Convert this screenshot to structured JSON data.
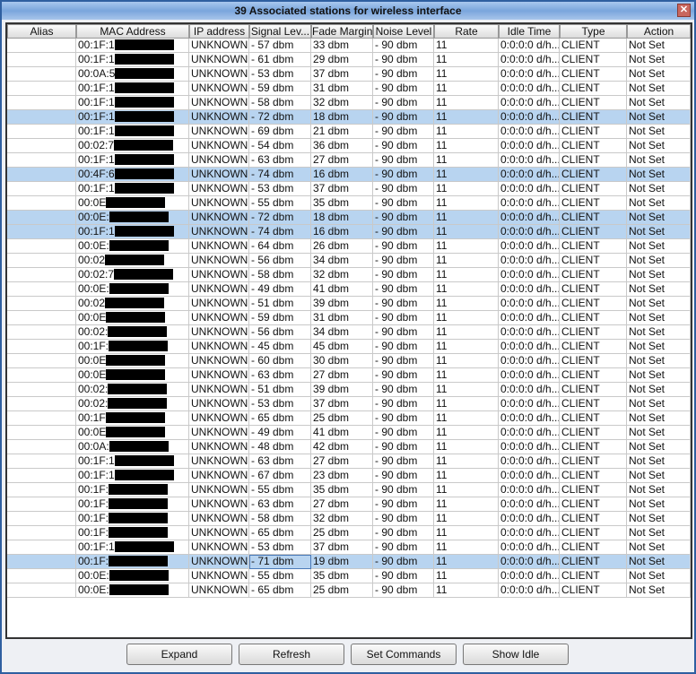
{
  "title": "39 Associated stations for wireless interface",
  "columns": [
    "Alias",
    "MAC Address",
    "IP address",
    "Signal Lev...",
    "Fade Margin",
    "Noise Level",
    "Rate",
    "Idle Time",
    "Type",
    "Action"
  ],
  "rows": [
    [
      "",
      "00:1F:1",
      "UNKNOWN",
      "- 57 dbm",
      "33 dbm",
      "- 90 dbm",
      "11",
      "0:0:0:0 d/h...",
      "CLIENT",
      "Not Set",
      0
    ],
    [
      "",
      "00:1F:1",
      "UNKNOWN",
      "- 61 dbm",
      "29 dbm",
      "- 90 dbm",
      "11",
      "0:0:0:0 d/h...",
      "CLIENT",
      "Not Set",
      0
    ],
    [
      "",
      "00:0A:5",
      "UNKNOWN",
      "- 53 dbm",
      "37 dbm",
      "- 90 dbm",
      "11",
      "0:0:0:0 d/h...",
      "CLIENT",
      "Not Set",
      0
    ],
    [
      "",
      "00:1F:1",
      "UNKNOWN",
      "- 59 dbm",
      "31 dbm",
      "- 90 dbm",
      "11",
      "0:0:0:0 d/h...",
      "CLIENT",
      "Not Set",
      0
    ],
    [
      "",
      "00:1F:1",
      "UNKNOWN",
      "- 58 dbm",
      "32 dbm",
      "- 90 dbm",
      "11",
      "0:0:0:0 d/h...",
      "CLIENT",
      "Not Set",
      0
    ],
    [
      "",
      "00:1F:1",
      "UNKNOWN",
      "- 72 dbm",
      "18 dbm",
      "- 90 dbm",
      "11",
      "0:0:0:0 d/h...",
      "CLIENT",
      "Not Set",
      1
    ],
    [
      "",
      "00:1F:1",
      "UNKNOWN",
      "- 69 dbm",
      "21 dbm",
      "- 90 dbm",
      "11",
      "0:0:0:0 d/h...",
      "CLIENT",
      "Not Set",
      0
    ],
    [
      "",
      "00:02:7",
      "UNKNOWN",
      "- 54 dbm",
      "36 dbm",
      "- 90 dbm",
      "11",
      "0:0:0:0 d/h...",
      "CLIENT",
      "Not Set",
      0
    ],
    [
      "",
      "00:1F:1",
      "UNKNOWN",
      "- 63 dbm",
      "27 dbm",
      "- 90 dbm",
      "11",
      "0:0:0:0 d/h...",
      "CLIENT",
      "Not Set",
      0
    ],
    [
      "",
      "00:4F:6",
      "UNKNOWN",
      "- 74 dbm",
      "16 dbm",
      "- 90 dbm",
      "11",
      "0:0:0:0 d/h...",
      "CLIENT",
      "Not Set",
      1
    ],
    [
      "",
      "00:1F:1",
      "UNKNOWN",
      "- 53 dbm",
      "37 dbm",
      "- 90 dbm",
      "11",
      "0:0:0:0 d/h...",
      "CLIENT",
      "Not Set",
      0
    ],
    [
      "",
      "00:0E",
      "UNKNOWN",
      "- 55 dbm",
      "35 dbm",
      "- 90 dbm",
      "11",
      "0:0:0:0 d/h...",
      "CLIENT",
      "Not Set",
      0
    ],
    [
      "",
      "00:0E:",
      "UNKNOWN",
      "- 72 dbm",
      "18 dbm",
      "- 90 dbm",
      "11",
      "0:0:0:0 d/h...",
      "CLIENT",
      "Not Set",
      1
    ],
    [
      "",
      "00:1F:1",
      "UNKNOWN",
      "- 74 dbm",
      "16 dbm",
      "- 90 dbm",
      "11",
      "0:0:0:0 d/h...",
      "CLIENT",
      "Not Set",
      1
    ],
    [
      "",
      "00:0E:",
      "UNKNOWN",
      "- 64 dbm",
      "26 dbm",
      "- 90 dbm",
      "11",
      "0:0:0:0 d/h...",
      "CLIENT",
      "Not Set",
      0
    ],
    [
      "",
      "00:02",
      "UNKNOWN",
      "- 56 dbm",
      "34 dbm",
      "- 90 dbm",
      "11",
      "0:0:0:0 d/h...",
      "CLIENT",
      "Not Set",
      0
    ],
    [
      "",
      "00:02:7",
      "UNKNOWN",
      "- 58 dbm",
      "32 dbm",
      "- 90 dbm",
      "11",
      "0:0:0:0 d/h...",
      "CLIENT",
      "Not Set",
      0
    ],
    [
      "",
      "00:0E:",
      "UNKNOWN",
      "- 49 dbm",
      "41 dbm",
      "- 90 dbm",
      "11",
      "0:0:0:0 d/h...",
      "CLIENT",
      "Not Set",
      0
    ],
    [
      "",
      "00:02",
      "UNKNOWN",
      "- 51 dbm",
      "39 dbm",
      "- 90 dbm",
      "11",
      "0:0:0:0 d/h...",
      "CLIENT",
      "Not Set",
      0
    ],
    [
      "",
      "00:0E",
      "UNKNOWN",
      "- 59 dbm",
      "31 dbm",
      "- 90 dbm",
      "11",
      "0:0:0:0 d/h...",
      "CLIENT",
      "Not Set",
      0
    ],
    [
      "",
      "00:02:",
      "UNKNOWN",
      "- 56 dbm",
      "34 dbm",
      "- 90 dbm",
      "11",
      "0:0:0:0 d/h...",
      "CLIENT",
      "Not Set",
      0
    ],
    [
      "",
      "00:1F:",
      "UNKNOWN",
      "- 45 dbm",
      "45 dbm",
      "- 90 dbm",
      "11",
      "0:0:0:0 d/h...",
      "CLIENT",
      "Not Set",
      0
    ],
    [
      "",
      "00:0E",
      "UNKNOWN",
      "- 60 dbm",
      "30 dbm",
      "- 90 dbm",
      "11",
      "0:0:0:0 d/h...",
      "CLIENT",
      "Not Set",
      0
    ],
    [
      "",
      "00:0E",
      "UNKNOWN",
      "- 63 dbm",
      "27 dbm",
      "- 90 dbm",
      "11",
      "0:0:0:0 d/h...",
      "CLIENT",
      "Not Set",
      0
    ],
    [
      "",
      "00:02:",
      "UNKNOWN",
      "- 51 dbm",
      "39 dbm",
      "- 90 dbm",
      "11",
      "0:0:0:0 d/h...",
      "CLIENT",
      "Not Set",
      0
    ],
    [
      "",
      "00:02:",
      "UNKNOWN",
      "- 53 dbm",
      "37 dbm",
      "- 90 dbm",
      "11",
      "0:0:0:0 d/h...",
      "CLIENT",
      "Not Set",
      0
    ],
    [
      "",
      "00:1F",
      "UNKNOWN",
      "- 65 dbm",
      "25 dbm",
      "- 90 dbm",
      "11",
      "0:0:0:0 d/h...",
      "CLIENT",
      "Not Set",
      0
    ],
    [
      "",
      "00:0E",
      "UNKNOWN",
      "- 49 dbm",
      "41 dbm",
      "- 90 dbm",
      "11",
      "0:0:0:0 d/h...",
      "CLIENT",
      "Not Set",
      0
    ],
    [
      "",
      "00:0A:",
      "UNKNOWN",
      "- 48 dbm",
      "42 dbm",
      "- 90 dbm",
      "11",
      "0:0:0:0 d/h...",
      "CLIENT",
      "Not Set",
      0
    ],
    [
      "",
      "00:1F:1",
      "UNKNOWN",
      "- 63 dbm",
      "27 dbm",
      "- 90 dbm",
      "11",
      "0:0:0:0 d/h...",
      "CLIENT",
      "Not Set",
      0
    ],
    [
      "",
      "00:1F:1",
      "UNKNOWN",
      "- 67 dbm",
      "23 dbm",
      "- 90 dbm",
      "11",
      "0:0:0:0 d/h...",
      "CLIENT",
      "Not Set",
      0
    ],
    [
      "",
      "00:1F:",
      "UNKNOWN",
      "- 55 dbm",
      "35 dbm",
      "- 90 dbm",
      "11",
      "0:0:0:0 d/h...",
      "CLIENT",
      "Not Set",
      0
    ],
    [
      "",
      "00:1F:",
      "UNKNOWN",
      "- 63 dbm",
      "27 dbm",
      "- 90 dbm",
      "11",
      "0:0:0:0 d/h...",
      "CLIENT",
      "Not Set",
      0
    ],
    [
      "",
      "00:1F:",
      "UNKNOWN",
      "- 58 dbm",
      "32 dbm",
      "- 90 dbm",
      "11",
      "0:0:0:0 d/h...",
      "CLIENT",
      "Not Set",
      0
    ],
    [
      "",
      "00:1F:",
      "UNKNOWN",
      "- 65 dbm",
      "25 dbm",
      "- 90 dbm",
      "11",
      "0:0:0:0 d/h...",
      "CLIENT",
      "Not Set",
      0
    ],
    [
      "",
      "00:1F:1",
      "UNKNOWN",
      "- 53 dbm",
      "37 dbm",
      "- 90 dbm",
      "11",
      "0:0:0:0 d/h...",
      "CLIENT",
      "Not Set",
      0
    ],
    [
      "",
      "00:1F:",
      "UNKNOWN",
      "- 71 dbm",
      "19 dbm",
      "- 90 dbm",
      "11",
      "0:0:0:0 d/h...",
      "CLIENT",
      "Not Set",
      1
    ],
    [
      "",
      "00:0E:",
      "UNKNOWN",
      "- 55 dbm",
      "35 dbm",
      "- 90 dbm",
      "11",
      "0:0:0:0 d/h...",
      "CLIENT",
      "Not Set",
      0
    ],
    [
      "",
      "00:0E:",
      "UNKNOWN",
      "- 65 dbm",
      "25 dbm",
      "- 90 dbm",
      "11",
      "0:0:0:0 d/h...",
      "CLIENT",
      "Not Set",
      0
    ]
  ],
  "buttons": {
    "expand": "Expand",
    "refresh": "Refresh",
    "set_commands": "Set Commands",
    "show_idle": "Show Idle"
  },
  "close_icon": "close-icon"
}
